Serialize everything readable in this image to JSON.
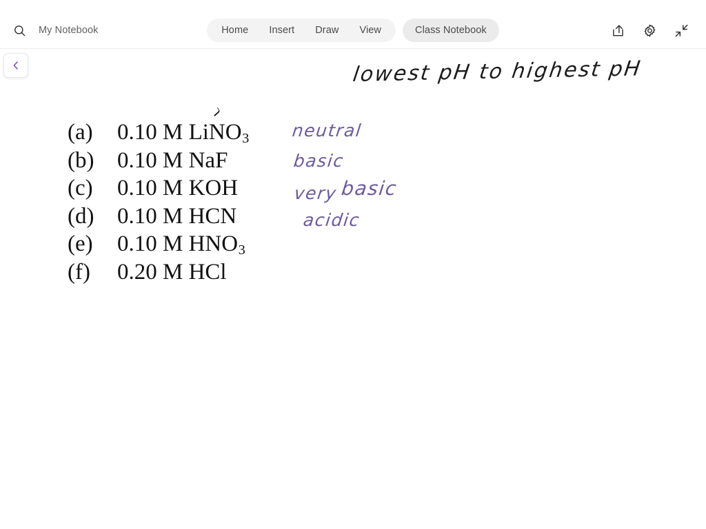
{
  "window": {
    "drag_handle_dots": 3
  },
  "header": {
    "search_icon": "search-icon",
    "notebook_title": "My Notebook",
    "tabs": [
      {
        "label": "Home",
        "active": true
      },
      {
        "label": "Insert",
        "active": false
      },
      {
        "label": "Draw",
        "active": false
      },
      {
        "label": "View",
        "active": false
      }
    ],
    "class_notebook_label": "Class Notebook",
    "actions": [
      {
        "name": "share-icon",
        "title": "Share"
      },
      {
        "name": "gear-icon",
        "title": "Settings"
      },
      {
        "name": "collapse-icon",
        "title": "Collapse"
      }
    ]
  },
  "back_button": {
    "icon": "chevron-left-icon",
    "color": "#6d3fb5"
  },
  "canvas": {
    "handwriting_title": "lowest pH to highest pH",
    "handwriting_title_color": "#1c1c1c",
    "ink_color": "#6d5a9e",
    "annotations": [
      {
        "text": "neutral",
        "for": "a"
      },
      {
        "text": "basic",
        "for": "b"
      },
      {
        "text": "very basic",
        "for": "c"
      },
      {
        "text": "acidic",
        "for": "d"
      }
    ],
    "annotation_very": "very",
    "annotation_very_basic": "basic",
    "question_items": [
      {
        "label": "(a)",
        "concentration": "0.10 M",
        "formula": "LiNO",
        "subscript": "3",
        "has_ink_mark": true
      },
      {
        "label": "(b)",
        "concentration": "0.10 M",
        "formula": "NaF",
        "subscript": "",
        "has_ink_mark": false
      },
      {
        "label": "(c)",
        "concentration": "0.10 M",
        "formula": "KOH",
        "subscript": "",
        "has_ink_mark": false
      },
      {
        "label": "(d)",
        "concentration": "0.10 M",
        "formula": "HCN",
        "subscript": "",
        "has_ink_mark": false
      },
      {
        "label": "(e)",
        "concentration": "0.10 M",
        "formula": "HNO",
        "subscript": "3",
        "has_ink_mark": false
      },
      {
        "label": "(f)",
        "concentration": "0.20 M",
        "formula": "HCl",
        "subscript": "",
        "has_ink_mark": false
      }
    ]
  }
}
